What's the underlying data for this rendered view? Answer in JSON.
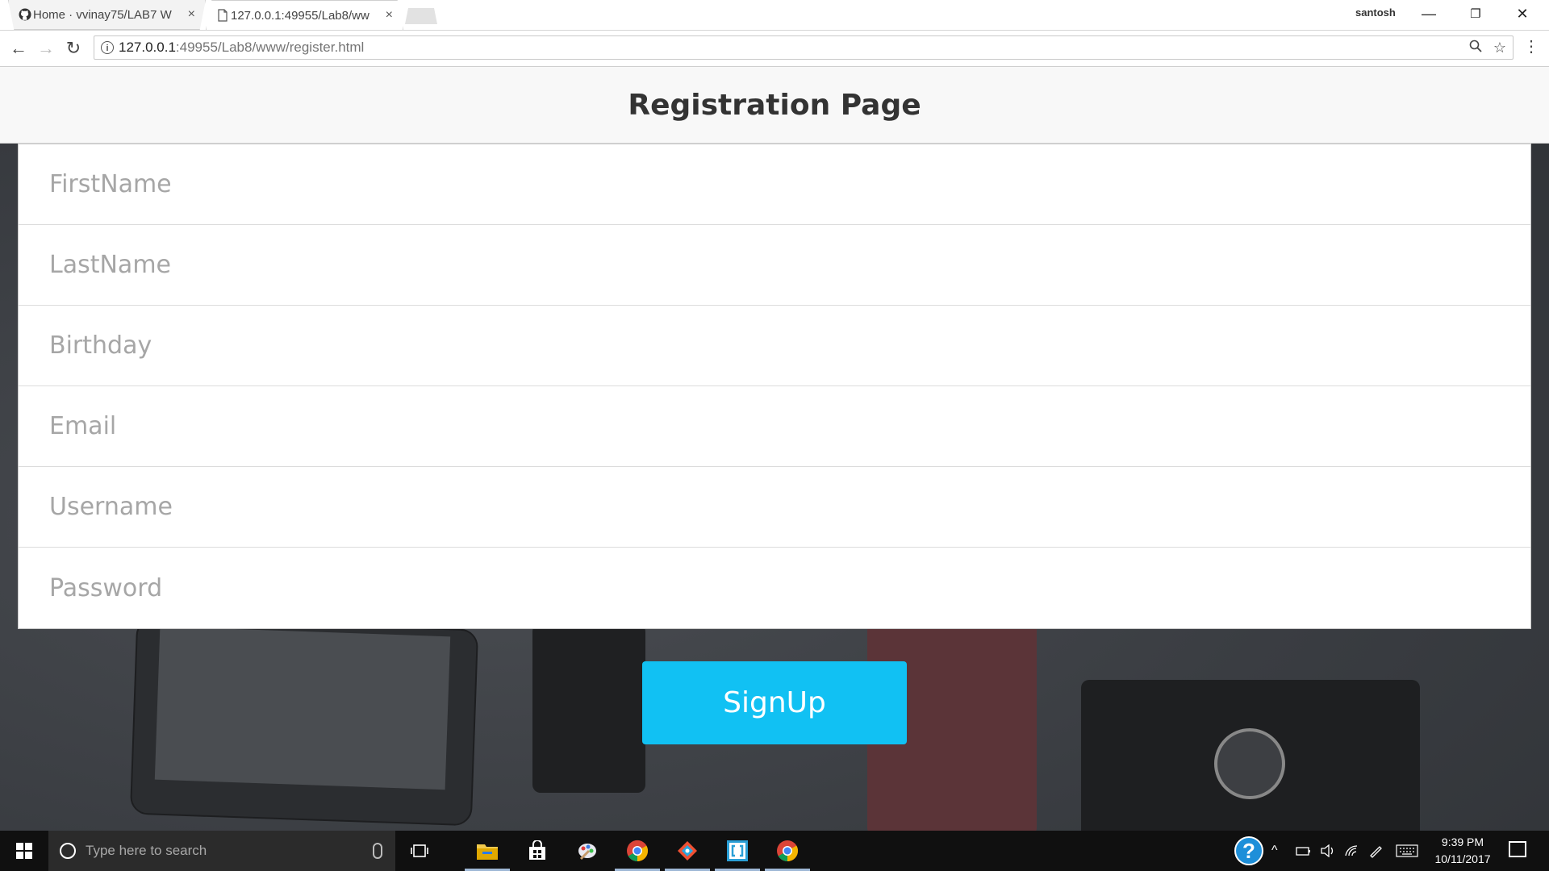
{
  "browser": {
    "tabs": [
      {
        "title": "Home · vvinay75/LAB7 W",
        "close": "×"
      },
      {
        "title": "127.0.0.1:49955/Lab8/ww",
        "close": "×"
      }
    ],
    "profile_name": "santosh",
    "window_controls": {
      "minimize": "—",
      "restore": "❐",
      "close": "✕"
    },
    "nav": {
      "back": "←",
      "forward": "→",
      "reload": "↻"
    },
    "url": {
      "host": "127.0.0.1",
      "rest": ":49955/Lab8/www/register.html"
    },
    "omnibox_icons": {
      "zoom": "🔍",
      "star": "☆"
    },
    "menu": "⋮"
  },
  "page": {
    "title": "Registration Page",
    "fields": [
      {
        "placeholder": "FirstName",
        "value": ""
      },
      {
        "placeholder": "LastName",
        "value": ""
      },
      {
        "placeholder": "Birthday",
        "value": ""
      },
      {
        "placeholder": "Email",
        "value": ""
      },
      {
        "placeholder": "Username",
        "value": ""
      },
      {
        "placeholder": "Password",
        "value": ""
      }
    ],
    "signup_label": "SignUp",
    "accent_color": "#11c1f3"
  },
  "taskbar": {
    "search_placeholder": "Type here to search",
    "apps": [
      "file-explorer-icon",
      "store-icon",
      "paint-icon",
      "chrome-icon",
      "git-icon",
      "brackets-icon",
      "chrome-icon"
    ],
    "tray": {
      "help": "?",
      "up": "^"
    },
    "time": "9:39 PM",
    "date": "10/11/2017"
  }
}
